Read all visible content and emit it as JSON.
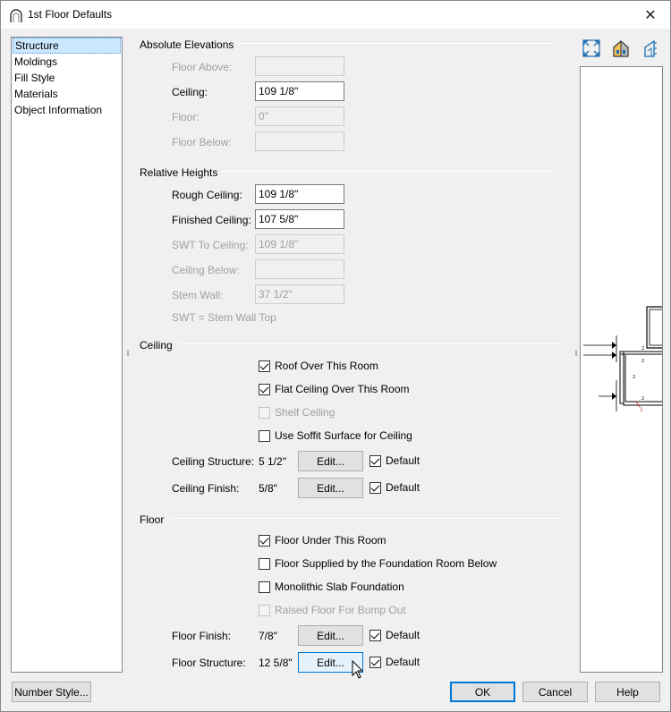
{
  "window": {
    "title": "1st Floor Defaults",
    "close_glyph": "✕"
  },
  "nav": {
    "items": [
      {
        "label": "Structure",
        "selected": true
      },
      {
        "label": "Moldings",
        "selected": false
      },
      {
        "label": "Fill Style",
        "selected": false
      },
      {
        "label": "Materials",
        "selected": false
      },
      {
        "label": "Object Information",
        "selected": false
      }
    ]
  },
  "absolute": {
    "title": "Absolute Elevations",
    "floor_above": {
      "label": "Floor Above:",
      "value": ""
    },
    "ceiling": {
      "label": "Ceiling:",
      "value": "109 1/8\""
    },
    "floor": {
      "label": "Floor:",
      "value": "0\""
    },
    "floor_below": {
      "label": "Floor Below:",
      "value": ""
    }
  },
  "relative": {
    "title": "Relative Heights",
    "rough_ceiling": {
      "label": "Rough Ceiling:",
      "value": "109 1/8\""
    },
    "finished_ceiling": {
      "label": "Finished Ceiling:",
      "value": "107 5/8\""
    },
    "swt_to_ceiling": {
      "label": "SWT To Ceiling:",
      "value": "109 1/8\""
    },
    "ceiling_below": {
      "label": "Ceiling Below:",
      "value": ""
    },
    "stem_wall": {
      "label": "Stem Wall:",
      "value": "37 1/2\""
    },
    "note": "SWT = Stem Wall Top"
  },
  "ceiling": {
    "title": "Ceiling",
    "roof_over": {
      "label": "Roof Over This Room",
      "checked": true
    },
    "flat_ceiling": {
      "label": "Flat Ceiling Over This Room",
      "checked": true
    },
    "shelf_ceiling": {
      "label": "Shelf Ceiling",
      "checked": false
    },
    "soffit": {
      "label": "Use Soffit Surface for Ceiling",
      "checked": false
    },
    "structure": {
      "label": "Ceiling Structure:",
      "value": "5 1/2\"",
      "edit": "Edit...",
      "default": "Default"
    },
    "finish": {
      "label": "Ceiling Finish:",
      "value": "5/8\"",
      "edit": "Edit...",
      "default": "Default"
    }
  },
  "floor": {
    "title": "Floor",
    "under_room": {
      "label": "Floor Under This Room",
      "checked": true
    },
    "foundation": {
      "label": "Floor Supplied by the Foundation Room Below",
      "checked": false
    },
    "slab": {
      "label": "Monolithic Slab Foundation",
      "checked": false
    },
    "raised": {
      "label": "Raised Floor For Bump Out",
      "checked": false
    },
    "finish": {
      "label": "Floor Finish:",
      "value": "7/8\"",
      "edit": "Edit...",
      "default": "Default"
    },
    "structure": {
      "label": "Floor Structure:",
      "value": "12 5/8\"",
      "edit": "Edit...",
      "default": "Default"
    }
  },
  "footer": {
    "number_style": "Number Style...",
    "ok": "OK",
    "cancel": "Cancel",
    "help": "Help"
  },
  "toolbar": {
    "icons": [
      "fit-view-icon",
      "house-icon",
      "elevation-view-icon"
    ]
  }
}
